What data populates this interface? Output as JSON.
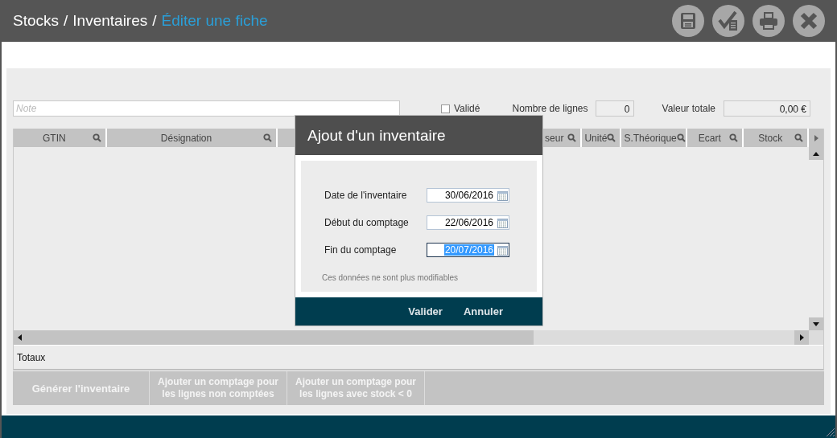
{
  "window": {
    "breadcrumb": [
      {
        "label": "Stocks",
        "separator": "/"
      },
      {
        "label": "Inventaires",
        "separator": "/"
      }
    ],
    "title": "Éditer une fiche"
  },
  "note": {
    "placeholder": "Note"
  },
  "validated": {
    "label": "Validé",
    "checked": false
  },
  "line_count": {
    "label": "Nombre de lignes",
    "value": "0"
  },
  "total_value": {
    "label": "Valeur totale",
    "value": "0,00 €"
  },
  "table": {
    "columns": [
      {
        "label": "GTIN"
      },
      {
        "label": "Désignation"
      },
      {
        "label": "seur"
      },
      {
        "label": "Unité"
      },
      {
        "label": "S.Théorique"
      },
      {
        "label": "Ecart"
      },
      {
        "label": "Stock"
      }
    ],
    "totals_label": "Totaux"
  },
  "actions": [
    {
      "label": "Générer l'inventaire"
    },
    {
      "label": "Ajouter un comptage pour les lignes non comptées"
    },
    {
      "label": "Ajouter un comptage pour les lignes avec stock < 0"
    }
  ],
  "dialog": {
    "title": "Ajout d'un inventaire",
    "fields": [
      {
        "label": "Date de l'inventaire",
        "value": "30/06/2016",
        "focused": false
      },
      {
        "label": "Début du comptage",
        "value": "22/06/2016",
        "focused": false
      },
      {
        "label": "Fin du comptage",
        "value": "20/07/2016",
        "focused": true
      }
    ],
    "note": "Ces données ne sont plus modifiables",
    "buttons": [
      "Valider",
      "Annuler"
    ]
  }
}
